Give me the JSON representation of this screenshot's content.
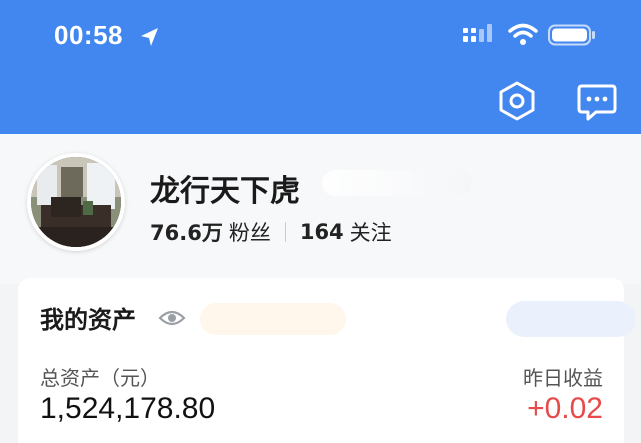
{
  "status_bar": {
    "time": "00:58"
  },
  "header": {
    "settings_icon": "hexagon-settings-icon",
    "message_icon": "chat-bubble-icon"
  },
  "profile": {
    "username": "龙行天下虎",
    "followers_count": "76.6万",
    "followers_label": "粉丝",
    "following_count": "164",
    "following_label": "关注"
  },
  "assets": {
    "title": "我的资产",
    "total_label": "总资产（元）",
    "total_value": "1,524,178.80",
    "yesterday_label": "昨日收益",
    "yesterday_value": "+0.02"
  },
  "colors": {
    "header_bg": "#4286f0",
    "profit": "#e84a4a"
  }
}
